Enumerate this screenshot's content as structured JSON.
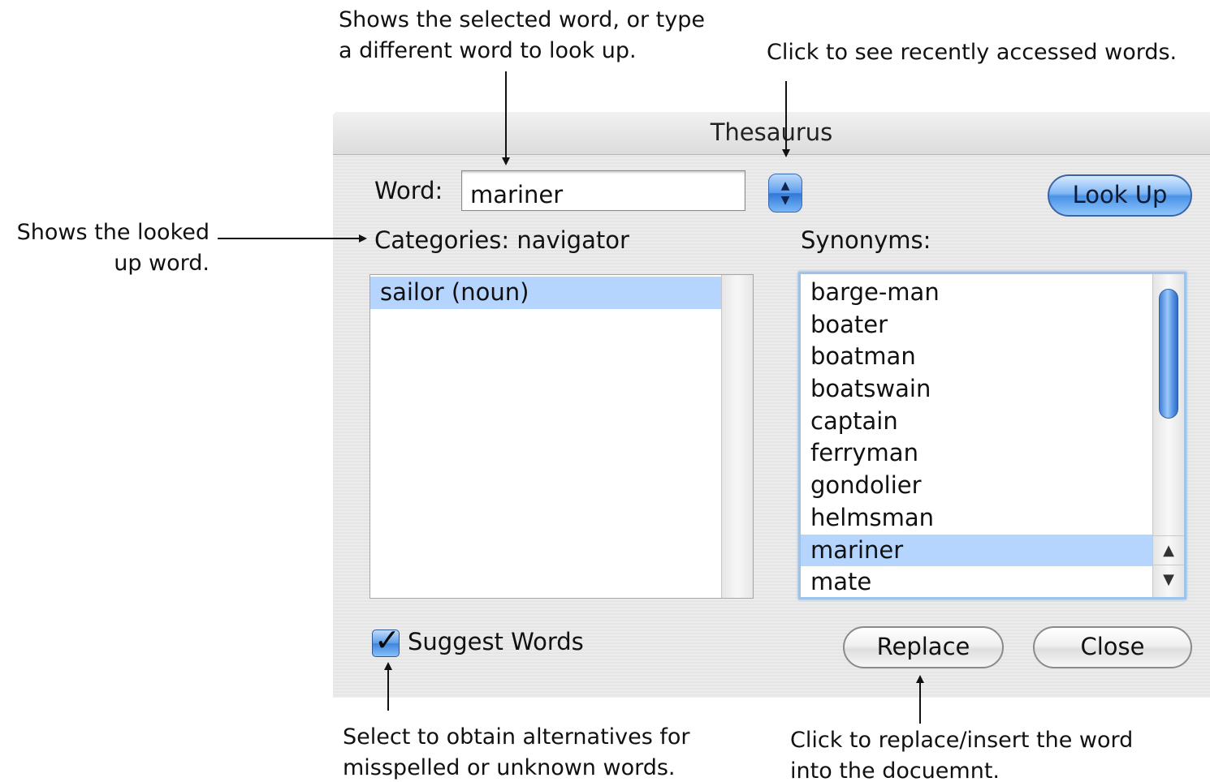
{
  "window": {
    "title": "Thesaurus"
  },
  "word_field": {
    "label": "Word:",
    "value": "mariner"
  },
  "history_button": {
    "icon": "up-down-arrows-icon",
    "glyph_up": "▲",
    "glyph_down": "▼"
  },
  "look_up_button": {
    "label": "Look Up"
  },
  "categories": {
    "label": "Categories:",
    "looked_up_word": "navigator",
    "items": [
      {
        "label": "sailor (noun)",
        "selected": true
      }
    ]
  },
  "synonyms": {
    "label": "Synonyms:",
    "items": [
      {
        "label": "barge-man"
      },
      {
        "label": "boater"
      },
      {
        "label": "boatman"
      },
      {
        "label": "boatswain"
      },
      {
        "label": "captain"
      },
      {
        "label": "ferryman"
      },
      {
        "label": "gondolier"
      },
      {
        "label": "helmsman"
      },
      {
        "label": "mariner",
        "selected": true
      },
      {
        "label": "mate"
      }
    ],
    "scroll_up_glyph": "▲",
    "scroll_down_glyph": "▼"
  },
  "suggest_words": {
    "label": "Suggest Words",
    "checked": true,
    "check_glyph": "✓"
  },
  "replace_button": {
    "label": "Replace"
  },
  "close_button": {
    "label": "Close"
  },
  "callouts": {
    "word_field_line1": "Shows the selected word, or type",
    "word_field_line2": "a different word to look up.",
    "history": "Click to see recently accessed words.",
    "looked_up_line1": "Shows the looked",
    "looked_up_line2": "up word.",
    "suggest_line1": "Select to obtain alternatives for",
    "suggest_line2": "misspelled or unknown words.",
    "replace_line1": "Click to replace/insert the word",
    "replace_line2": "into the docuemnt."
  },
  "colors": {
    "selection": "#b5d5ff",
    "aqua_blue": "#4a92e6",
    "focus_ring": "#9ec3ea"
  }
}
